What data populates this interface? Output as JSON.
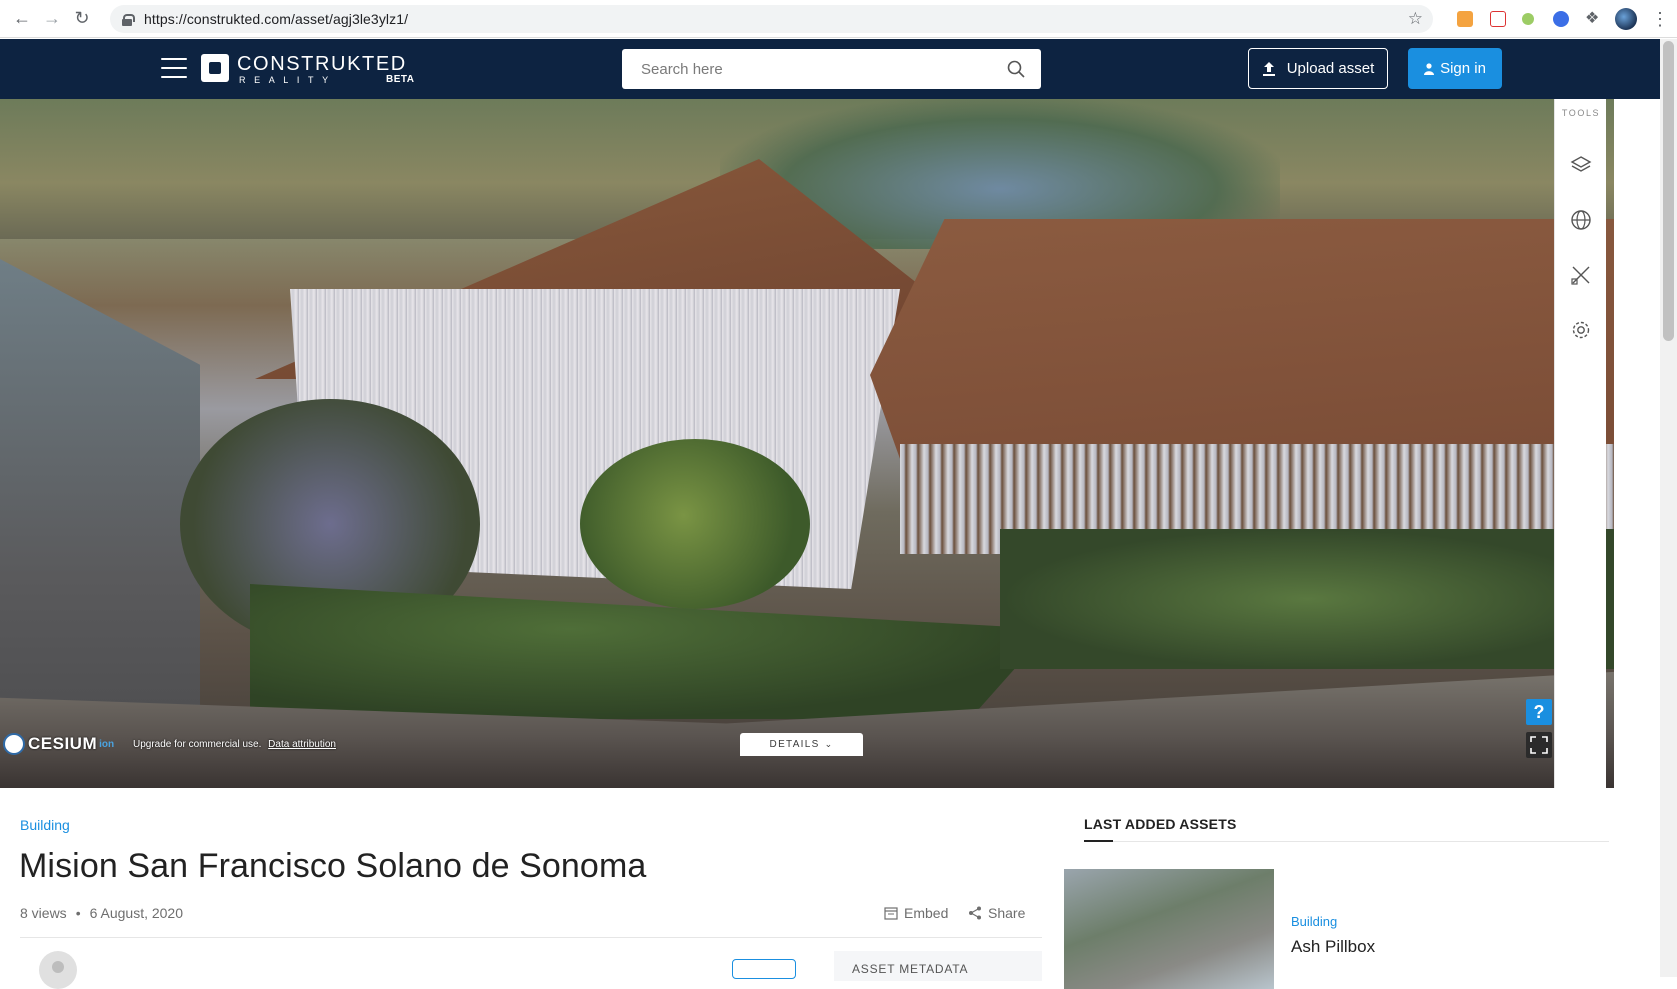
{
  "browser": {
    "url": "https://construkted.com/asset/agj3le3ylz1/"
  },
  "header": {
    "logo_text": "CONSTRUKTED",
    "logo_sub": "REALITY",
    "logo_badge": "BETA",
    "search_placeholder": "Search here",
    "upload_label": "Upload asset",
    "signin_label": "Sign in"
  },
  "viewer": {
    "cesium_name": "CESIUM",
    "cesium_ion": "ion",
    "credit_text": "Upgrade for commercial use.",
    "credit_link": "Data attribution",
    "details_label": "DETAILS",
    "help_label": "?",
    "tools_label": "TOOLS",
    "tool_icons": [
      "layers-icon",
      "globe-icon",
      "measure-tools-icon",
      "settings-icon"
    ]
  },
  "asset": {
    "category": "Building",
    "title": "Mision San Francisco Solano de Sonoma",
    "views": "8 views",
    "date": "6 August, 2020",
    "embed_label": "Embed",
    "share_label": "Share",
    "metadata_label": "ASSET METADATA"
  },
  "sidebar": {
    "heading": "LAST ADDED ASSETS",
    "items": [
      {
        "category": "Building",
        "title": "Ash Pillbox"
      }
    ]
  },
  "colors": {
    "header_bg": "#0d2341",
    "accent": "#1a8fe0"
  }
}
